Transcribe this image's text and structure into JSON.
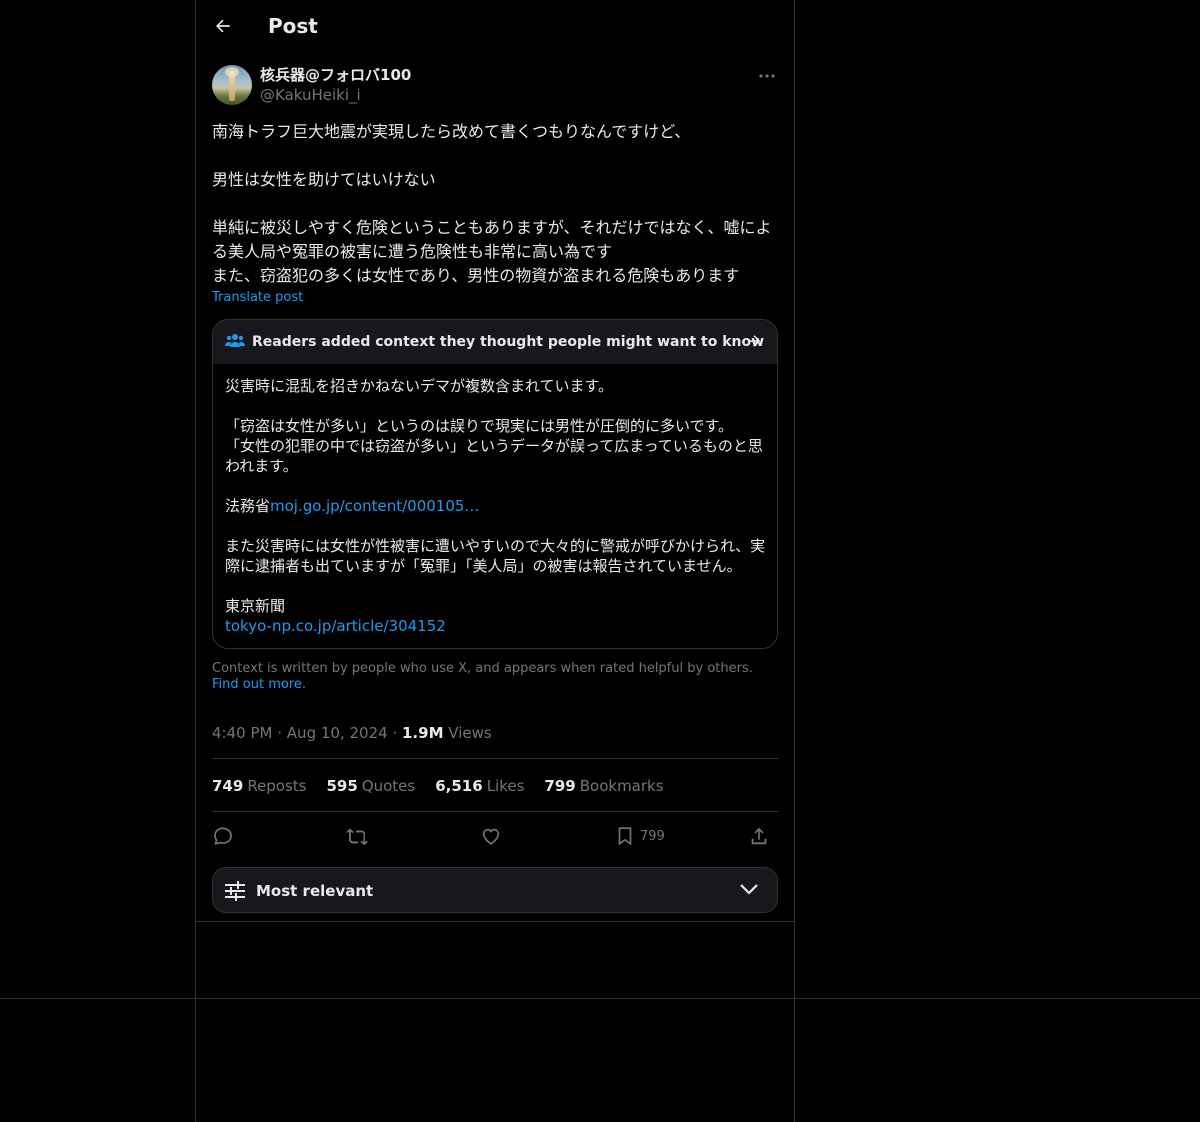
{
  "header": {
    "title": "Post"
  },
  "author": {
    "display_name": "核兵器@フォロバ100",
    "handle": "@KakuHeiki_i"
  },
  "post": {
    "text": "南海トラフ巨大地震が実現したら改めて書くつもりなんですけど、\n\n男性は女性を助けてはいけない\n\n単純に被災しやすく危険ということもありますが、それだけではなく、嘘による美人局や冤罪の被害に遭う危険性も非常に高い為です\nまた、窃盗犯の多くは女性であり、男性の物資が盗まれる危険もあります",
    "translate_label": "Translate post"
  },
  "note": {
    "title": "Readers added context they thought people might want to know",
    "p1": "災害時に混乱を招きかねないデマが複数含まれています。",
    "p2": "「窃盗は女性が多い」というのは誤りで現実には男性が圧倒的に多いです。\n「女性の犯罪の中では窃盗が多い」というデータが誤って広まっているものと思われます。",
    "p3_prefix": "法務省",
    "p3_link": "moj.go.jp/content/000105…",
    "p4": "また災害時には女性が性被害に遭いやすいので大々的に警戒が呼びかけられ、実際に逮捕者も出ていますが「冤罪」「美人局」の被害は報告されていません。",
    "p5": "東京新聞",
    "p5_link": "tokyo-np.co.jp/article/304152"
  },
  "context_footer": {
    "text": "Context is written by people who use X, and appears when rated helpful by others.",
    "link": "Find out more."
  },
  "meta": {
    "time": "4:40 PM",
    "date": "Aug 10, 2024",
    "views_count": "1.9M",
    "views_label": "Views",
    "sep": "·"
  },
  "stats": {
    "reposts": "749",
    "reposts_label": "Reposts",
    "quotes": "595",
    "quotes_label": "Quotes",
    "likes": "6,516",
    "likes_label": "Likes",
    "bookmarks": "799",
    "bookmarks_label": "Bookmarks"
  },
  "actions": {
    "bookmark_count": "799"
  },
  "sort": {
    "label": "Most relevant"
  },
  "icons": [
    "arrow-left-icon",
    "more-horizontal-icon",
    "people-icon",
    "arrow-right-icon",
    "reply-icon",
    "repost-icon",
    "like-icon",
    "bookmark-icon",
    "share-icon",
    "sliders-icon",
    "chevron-down-icon"
  ],
  "colors": {
    "background": "#000000",
    "text": "#e7e9ea",
    "muted": "#71767b",
    "accent": "#1d9bf0",
    "border": "#2f3336",
    "panel": "#16181c"
  }
}
